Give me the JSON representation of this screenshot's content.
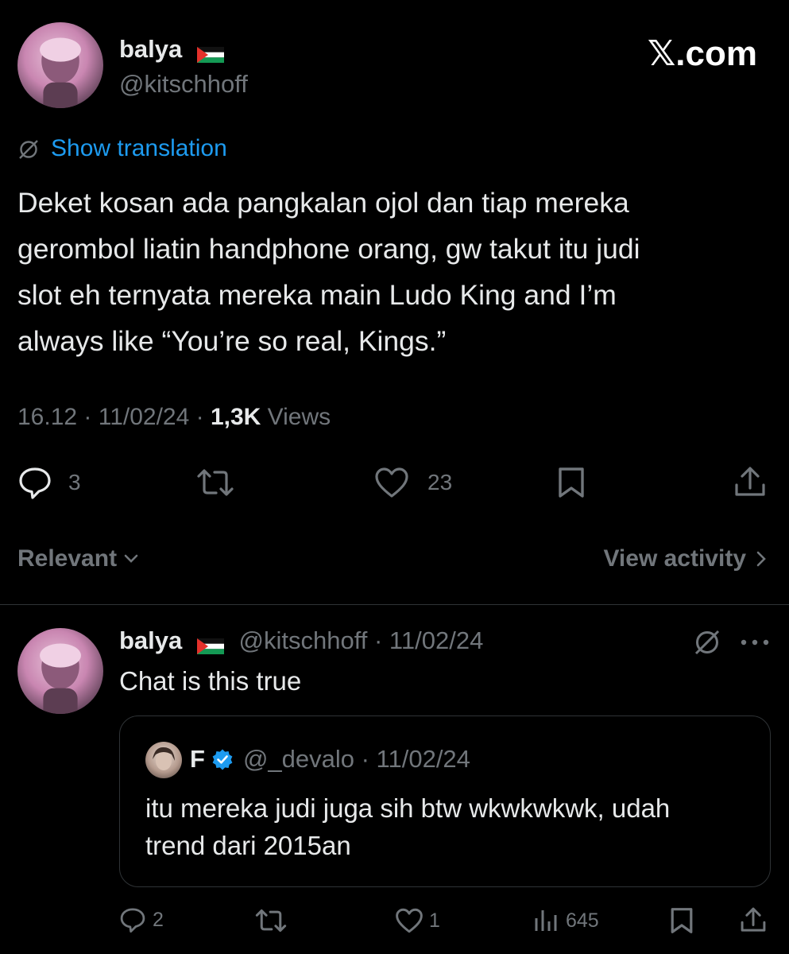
{
  "header": {
    "display_name": "balya",
    "handle": "@kitschhoff",
    "site_label": "𝕏.com"
  },
  "tweet": {
    "translate_label": "Show translation",
    "text_lines": [
      "Deket kosan ada pangkalan ojol dan tiap mereka",
      "gerombol liatin handphone orang, gw takut itu judi",
      "slot eh ternyata mereka main Ludo King and I’m",
      "always like “You’re so real, Kings.”"
    ],
    "meta_time": "16.12 · 11/02/24 · ",
    "meta_views_count": "1,3K",
    "meta_views_label": " Views",
    "replies": "3",
    "likes": "23"
  },
  "sort": {
    "label": "Relevant",
    "view_activity": "View activity"
  },
  "reply": {
    "display_name": "balya",
    "handle_date": "@kitschhoff · 11/02/24",
    "text": "Chat is this true",
    "replies": "2",
    "likes": "1",
    "views": "645",
    "quote": {
      "name": "F",
      "handle_date": "@_devalo · 11/02/24",
      "text_lines": [
        "itu mereka judi juga sih btw wkwkwkwk, udah",
        "trend dari 2015an"
      ]
    }
  },
  "colors": {
    "background": "#000000",
    "text": "#e7e9ea",
    "muted": "#71767b",
    "link": "#1d9bf0",
    "divider": "#2f3336"
  }
}
